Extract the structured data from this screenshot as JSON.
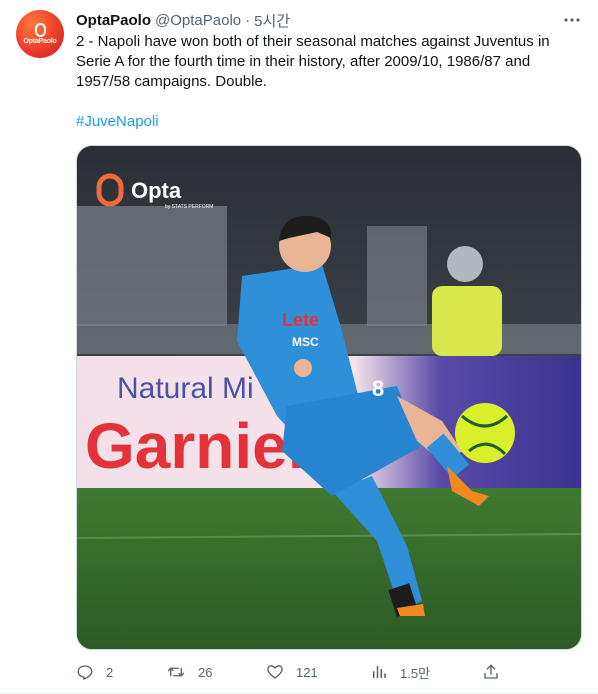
{
  "author": {
    "display_name": "OptaPaolo",
    "handle": "@OptaPaolo",
    "separator": "·",
    "time": "5시간",
    "avatar_text": "OptaPaolo"
  },
  "tweet": {
    "text": "2 - Napoli have won both of their seasonal matches against Juventus in Serie A for the fourth time in their history, after 2009/10, 1986/87 and 1957/58 campaigns. Double.",
    "hashtag": "#JuveNapoli"
  },
  "media": {
    "logo_text": "Opta",
    "logo_subtext": "by STATS PERFORM",
    "banner_top": "Natural Mi",
    "banner_brand": "Garnier",
    "shirt_sponsor": "Lete",
    "shirt_sponsor2": "MSC",
    "shirt_number": "8"
  },
  "actions": {
    "replies": "2",
    "retweets": "26",
    "likes": "121",
    "views": "1.5만"
  },
  "colors": {
    "accent": "#1d9bf0",
    "text_primary": "#0f1419",
    "text_secondary": "#536471",
    "napoli_blue": "#2f8fd8",
    "ball_yellow": "#d8ef2a"
  },
  "icons": {
    "more": "more-horizontal-icon",
    "reply": "reply-icon",
    "retweet": "retweet-icon",
    "like": "heart-icon",
    "views": "analytics-icon",
    "share": "share-icon"
  }
}
